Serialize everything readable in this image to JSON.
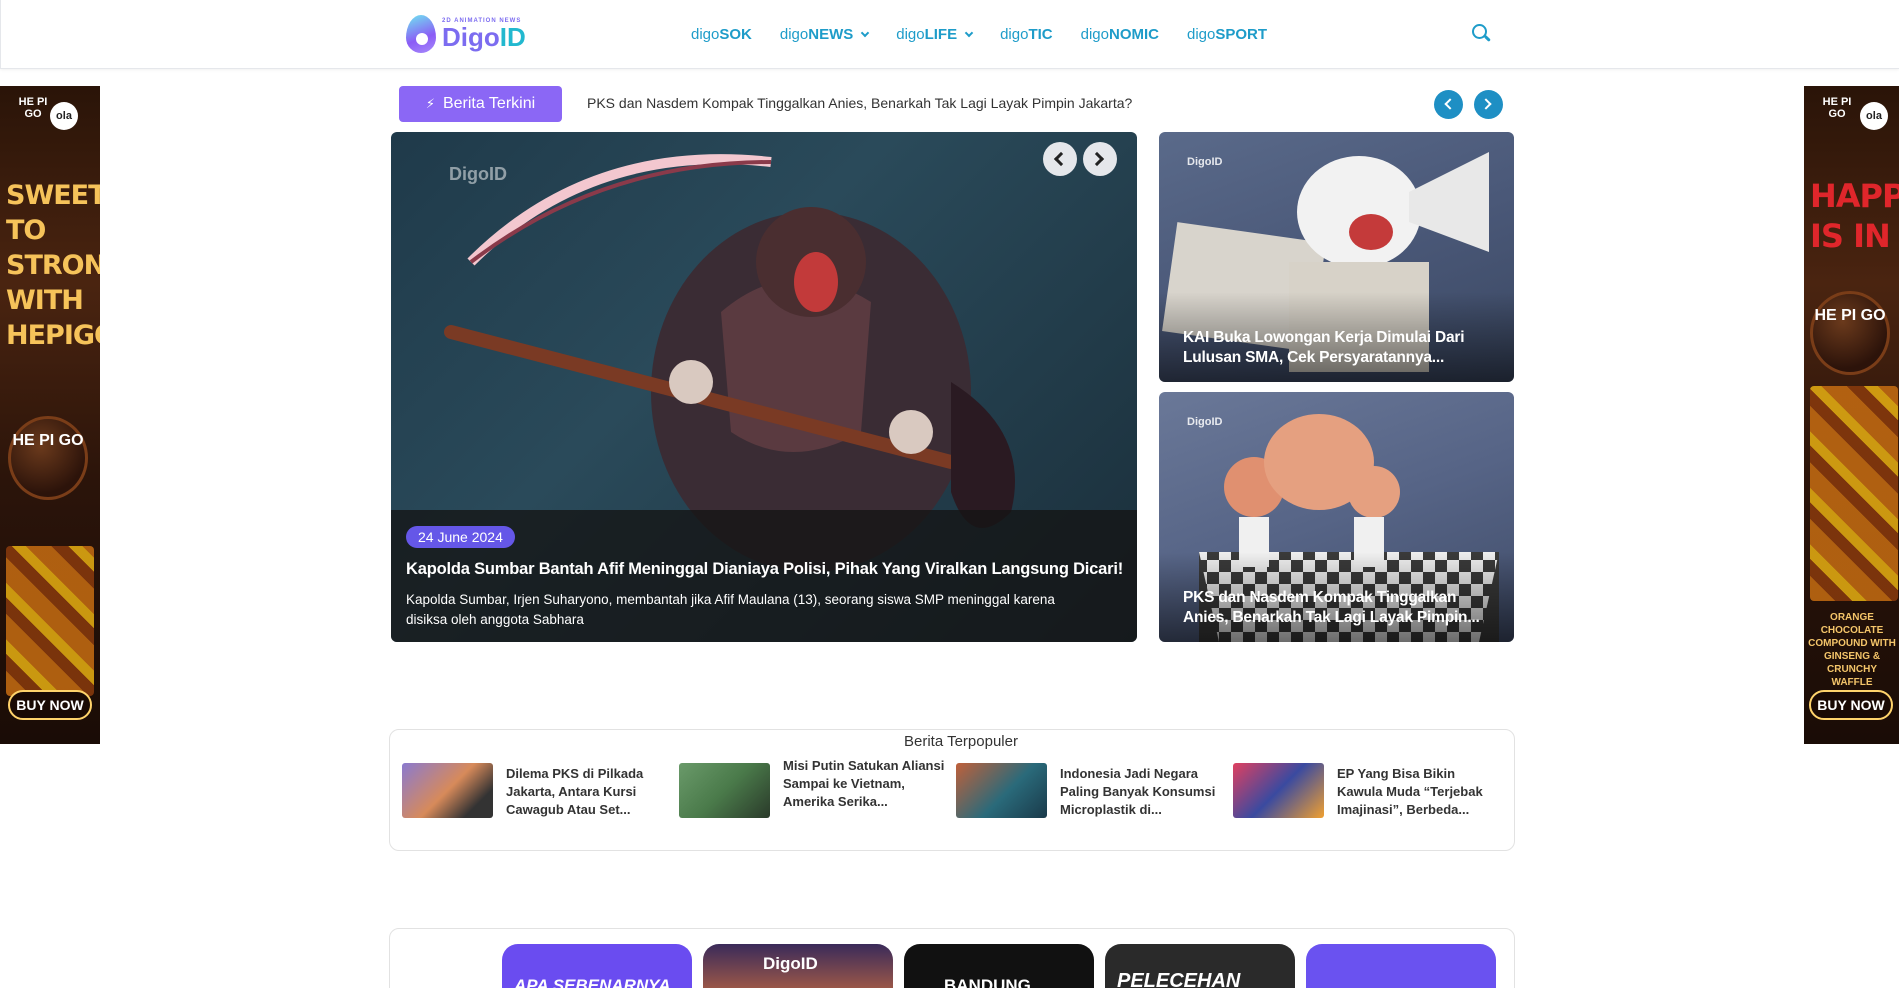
{
  "header": {
    "logo": {
      "tag": "2D ANIMATION NEWS",
      "name_a": "Digo",
      "name_b": "ID"
    },
    "nav": [
      {
        "prefix": "digo",
        "label": "SOK",
        "dropdown": false
      },
      {
        "prefix": "digo",
        "label": "NEWS",
        "dropdown": true
      },
      {
        "prefix": "digo",
        "label": "LIFE",
        "dropdown": true
      },
      {
        "prefix": "digo",
        "label": "TIC",
        "dropdown": false
      },
      {
        "prefix": "digo",
        "label": "NOMIC",
        "dropdown": false
      },
      {
        "prefix": "digo",
        "label": "SPORT",
        "dropdown": false
      }
    ]
  },
  "ads": {
    "left": {
      "brand": "HE PI GO",
      "ola": "ola",
      "headline": "SWEET TO STRONG WITH HEPIGO",
      "cookie": "HE PI GO",
      "buy": "BUY NOW"
    },
    "right": {
      "brand": "HE PI GO",
      "ola": "ola",
      "headline": "HAPPY IS IN",
      "cookie": "HE PI GO",
      "sub": "ORANGE CHOCOLATE COMPOUND WITH GINSENG & CRUNCHY WAFFLE",
      "buy": "BUY NOW"
    }
  },
  "ticker": {
    "label": "Berita Terkini",
    "text": "PKS dan Nasdem Kompak Tinggalkan Anies, Benarkah Tak Lagi Layak Pimpin Jakarta?"
  },
  "hero": {
    "watermark": "DigoID",
    "date": "24 June 2024",
    "title": "Kapolda Sumbar Bantah Afif Meninggal Dianiaya Polisi, Pihak Yang Viralkan Langsung Dicari!",
    "desc": "Kapolda Sumbar, Irjen Suharyono, membantah jika Afif Maulana (13), seorang siswa SMP meninggal karena disiksa oleh anggota Sabhara"
  },
  "cards": [
    {
      "watermark": "DigoID",
      "title": "KAI Buka Lowongan Kerja Dimulai Dari Lulusan SMA, Cek Persyaratannya..."
    },
    {
      "watermark": "DigoID",
      "title": "PKS dan Nasdem Kompak Tinggalkan Anies, Benarkah Tak Lagi Layak Pimpin..."
    }
  ],
  "popular": {
    "title": "Berita Terpopuler",
    "items": [
      {
        "text": "Dilema PKS di Pilkada Jakarta, Antara Kursi Cawagub Atau Set..."
      },
      {
        "text": "Misi Putin Satukan Aliansi Sampai ke Vietnam, Amerika Serika..."
      },
      {
        "text": "Indonesia Jadi Negara Paling Banyak Konsumsi Microplastik di..."
      },
      {
        "text": "EP Yang Bisa Bikin Kawula Muda “Terjebak Imajinasi”, Berbeda..."
      }
    ]
  },
  "bottom": {
    "cards": [
      {
        "label": "APA SEBENARNYA"
      },
      {
        "label": "DigoID"
      },
      {
        "label": "BANDUNG"
      },
      {
        "label": "PELECEHAN"
      },
      {
        "label": ""
      }
    ]
  }
}
